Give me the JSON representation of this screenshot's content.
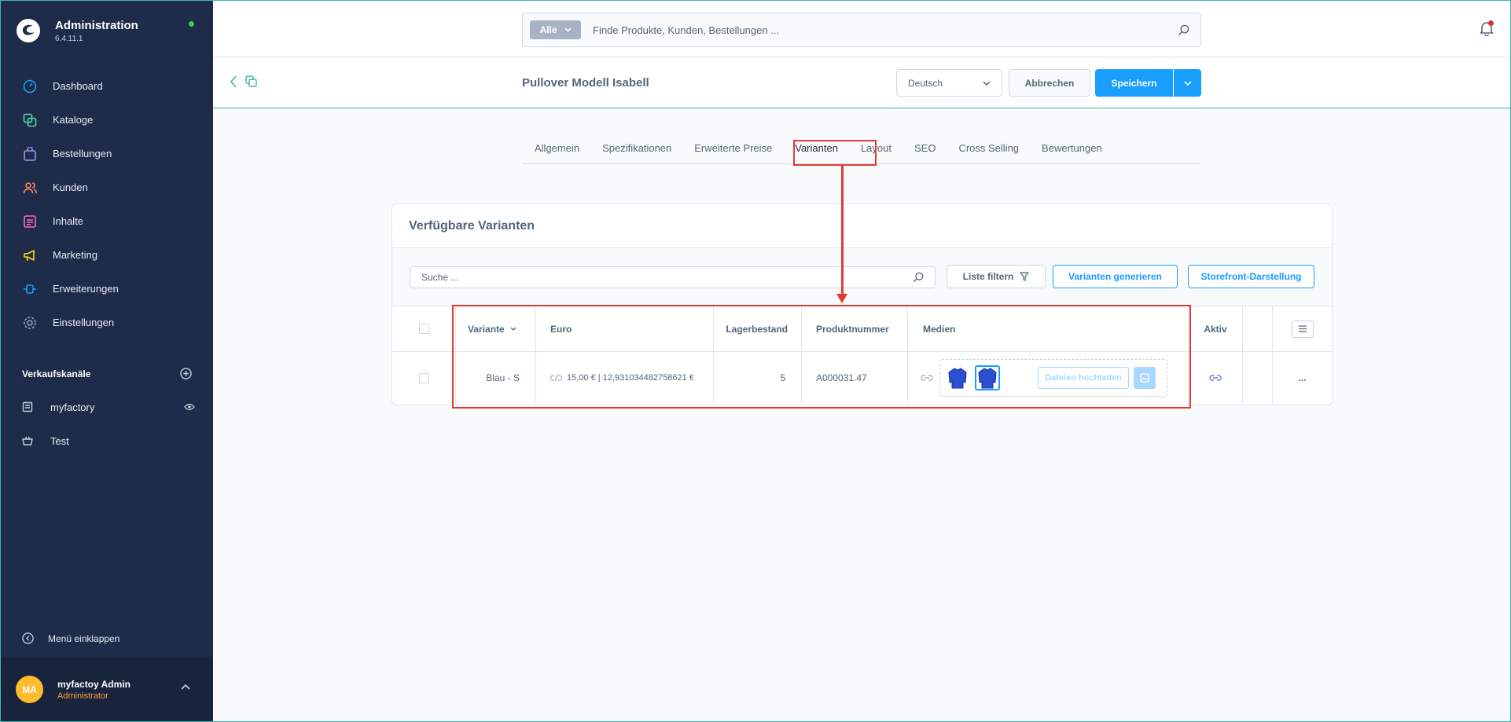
{
  "app": {
    "title": "Administration",
    "version": "6.4.11.1"
  },
  "sidebar": {
    "items": [
      {
        "label": "Dashboard",
        "icon": "gauge-icon",
        "color": "#189eff"
      },
      {
        "label": "Kataloge",
        "icon": "catalog-icon",
        "color": "#57d9a3"
      },
      {
        "label": "Bestellungen",
        "icon": "shopping-bag-icon",
        "color": "#a092f0"
      },
      {
        "label": "Kunden",
        "icon": "users-icon",
        "color": "#f88962"
      },
      {
        "label": "Inhalte",
        "icon": "content-icon",
        "color": "#ff68b4"
      },
      {
        "label": "Marketing",
        "icon": "megaphone-icon",
        "color": "#ffd700"
      },
      {
        "label": "Erweiterungen",
        "icon": "plugin-icon",
        "color": "#189eff"
      },
      {
        "label": "Einstellungen",
        "icon": "gear-icon",
        "color": "#9aa8b5"
      }
    ],
    "sales_channels_title": "Verkaufskanäle",
    "sales_channels": [
      {
        "label": "myfactory",
        "icon": "storefront-icon"
      },
      {
        "label": "Test",
        "icon": "basket-icon"
      }
    ],
    "collapse_label": "Menü einklappen",
    "user": {
      "initials": "MA",
      "name": "myfactoy Admin",
      "role": "Administrator"
    }
  },
  "search": {
    "type_label": "Alle",
    "placeholder": "Finde Produkte, Kunden, Bestellungen ..."
  },
  "smartbar": {
    "title": "Pullover Modell Isabell",
    "language": "Deutsch",
    "cancel_label": "Abbrechen",
    "save_label": "Speichern"
  },
  "tabs": [
    {
      "label": "Allgemein"
    },
    {
      "label": "Spezifikationen"
    },
    {
      "label": "Erweiterte Preise"
    },
    {
      "label": "Varianten"
    },
    {
      "label": "Layout"
    },
    {
      "label": "SEO"
    },
    {
      "label": "Cross Selling"
    },
    {
      "label": "Bewertungen"
    }
  ],
  "active_tab": "Varianten",
  "variants_card": {
    "title": "Verfügbare Varianten",
    "search_placeholder": "Suche ...",
    "filter_label": "Liste filtern",
    "generate_label": "Varianten generieren",
    "storefront_label": "Storefront-Darstellung",
    "columns": {
      "variant": "Variante",
      "euro": "Euro",
      "stock": "Lagerbestand",
      "product_number": "Produktnummer",
      "media": "Medien",
      "active": "Aktiv"
    },
    "rows": [
      {
        "variant": "Blau - S",
        "price": "15,00 € | 12,931034482758621 €",
        "stock": "5",
        "product_number": "A000031.47",
        "upload_label": "Dateien hochladen",
        "actions": "..."
      }
    ]
  },
  "colors": {
    "sidebar_bg": "#1e2b49",
    "accent": "#189eff",
    "highlight": "#e53935",
    "text": "#52667a"
  }
}
